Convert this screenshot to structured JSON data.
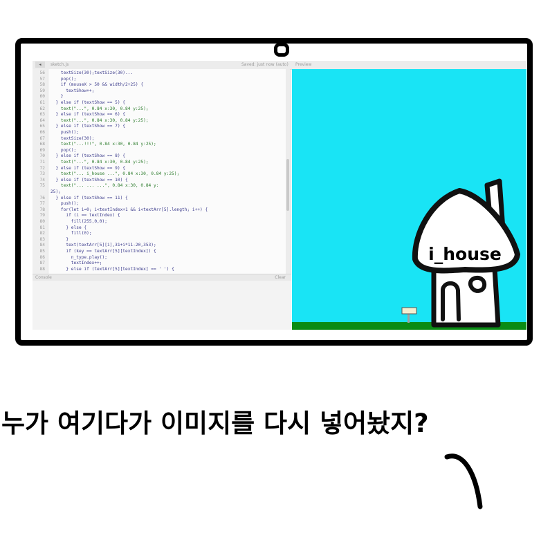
{
  "editor": {
    "nav_button": "◂",
    "file_label": "sketch.js",
    "status_label": "Saved: just now (auto)",
    "preview_label": "Preview",
    "console_label": "Console",
    "clear_label": "Clear",
    "lines": [
      {
        "n": "56",
        "t": "    textSize(30);textSize(30)...",
        "s": false
      },
      {
        "n": "57",
        "t": "    pop();",
        "s": false
      },
      {
        "n": "58",
        "t": "    if (mouseX > 50 && width/2+25) {",
        "s": false
      },
      {
        "n": "59",
        "t": "      textShow++;",
        "s": false
      },
      {
        "n": "60",
        "t": "    }",
        "s": false
      },
      {
        "n": "61",
        "t": "  } else if (textShow == 5) {",
        "s": false
      },
      {
        "n": "62",
        "t": "    text(\"...\", 0.84 x:30, 0.84 y:25);",
        "s": true
      },
      {
        "n": "63",
        "t": "  } else if (textShow == 6) {",
        "s": false
      },
      {
        "n": "64",
        "t": "    text(\"...\", 0.84 x:30, 0.84 y:25);",
        "s": true
      },
      {
        "n": "65",
        "t": "  } else if (textShow == 7) {",
        "s": false
      },
      {
        "n": "66",
        "t": "    push();",
        "s": false
      },
      {
        "n": "67",
        "t": "    textSize(30);",
        "s": false
      },
      {
        "n": "68",
        "t": "    text(\"...!!!\", 0.84 x:30, 0.84 y:25);",
        "s": true
      },
      {
        "n": "69",
        "t": "    pop();",
        "s": false
      },
      {
        "n": "70",
        "t": "  } else if (textShow == 8) {",
        "s": false
      },
      {
        "n": "71",
        "t": "    text(\"...\", 0.84 x:30, 0.84 y:25);",
        "s": true
      },
      {
        "n": "72",
        "t": "  } else if (textShow == 9) {",
        "s": false
      },
      {
        "n": "73",
        "t": "    text(\"... i_house ...\", 0.84 x:30, 0.84 y:25);",
        "s": true
      },
      {
        "n": "74",
        "t": "  } else if (textShow == 10) {",
        "s": false
      },
      {
        "n": "75",
        "t": "    text(\"... ... ...\", 0.84 x:30, 0.84 y:",
        "s": true
      },
      {
        "n": "",
        "t": "25);",
        "s": false
      },
      {
        "n": "76",
        "t": "  } else if (textShow == 11) {",
        "s": false
      },
      {
        "n": "77",
        "t": "    push();",
        "s": false
      },
      {
        "n": "78",
        "t": "    for(let i=0; i<textIndex+1 && i<textArr[5].length; i++) {",
        "s": false
      },
      {
        "n": "79",
        "t": "      if (i == textIndex) {",
        "s": false
      },
      {
        "n": "80",
        "t": "        fill(255,0,0);",
        "s": false
      },
      {
        "n": "81",
        "t": "      } else {",
        "s": false
      },
      {
        "n": "82",
        "t": "        fill(0);",
        "s": false
      },
      {
        "n": "83",
        "t": "      }",
        "s": false
      },
      {
        "n": "84",
        "t": "      text(textArr[5][i],31+i*11-20,353);",
        "s": false
      },
      {
        "n": "85",
        "t": "      if (key == textArr[5][textIndex]) {",
        "s": false
      },
      {
        "n": "86",
        "t": "        n_type.play();",
        "s": false
      },
      {
        "n": "87",
        "t": "        textIndex++;",
        "s": false
      },
      {
        "n": "88",
        "t": "      } else if (textArr[5][textIndex] == ' ') {",
        "s": false
      }
    ]
  },
  "canvas": {
    "house_label": "i_house",
    "sky_color": "#19e4f5",
    "ground_color": "#0a8c14"
  },
  "caption": "누가 여기다가 이미지를 다시 넣어놨지?"
}
